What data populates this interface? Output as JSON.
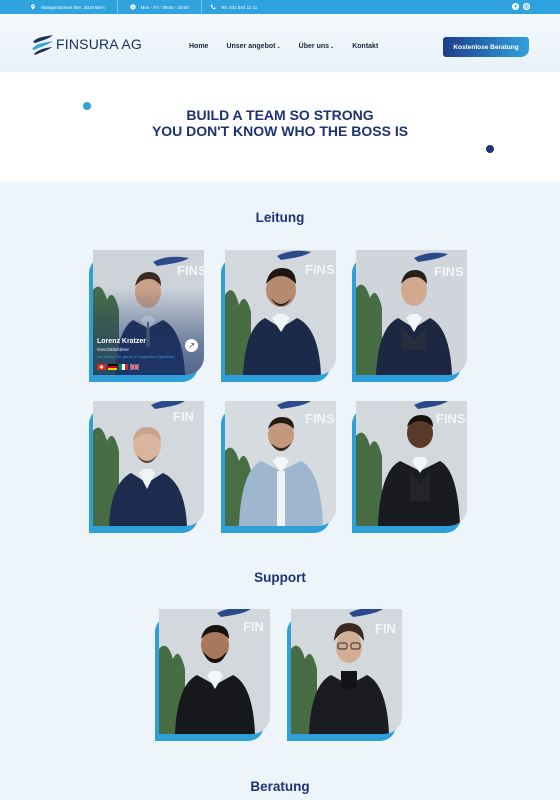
{
  "topbar": {
    "address": "Wangenstrasse 86A, 3018 Bern",
    "hours": "Mon - Fri : 09:00 - 19:00",
    "phone": "Tel. 031 544 11 11",
    "social": [
      "facebook-icon",
      "instagram-icon"
    ]
  },
  "header": {
    "logo_text": "FINSURA AG",
    "nav": [
      {
        "label": "Home"
      },
      {
        "label": "Unser angebot",
        "has_dropdown": true
      },
      {
        "label": "Über uns",
        "has_dropdown": true
      },
      {
        "label": "Kontakt"
      }
    ],
    "cta_label": "Kostenlose Beratung"
  },
  "hero": {
    "line1": "BUILD A TEAM SO STRONG",
    "line2": "YOU DON'T KNOW WHO THE BOSS IS"
  },
  "sections": {
    "leitung": "Leitung",
    "support": "Support",
    "beratung": "Beratung"
  },
  "featured_member": {
    "name": "Lorenz Kratzer",
    "role": "Geschäftsführer",
    "languages_note": "Ich berate Sie gerne in folgenden Sprachen:",
    "flags": [
      "swiss-flag-icon",
      "german-flag-icon",
      "italian-flag-icon",
      "uk-flag-icon"
    ]
  },
  "colors": {
    "accent": "#2ea3dd",
    "brand_navy": "#1d3277"
  }
}
